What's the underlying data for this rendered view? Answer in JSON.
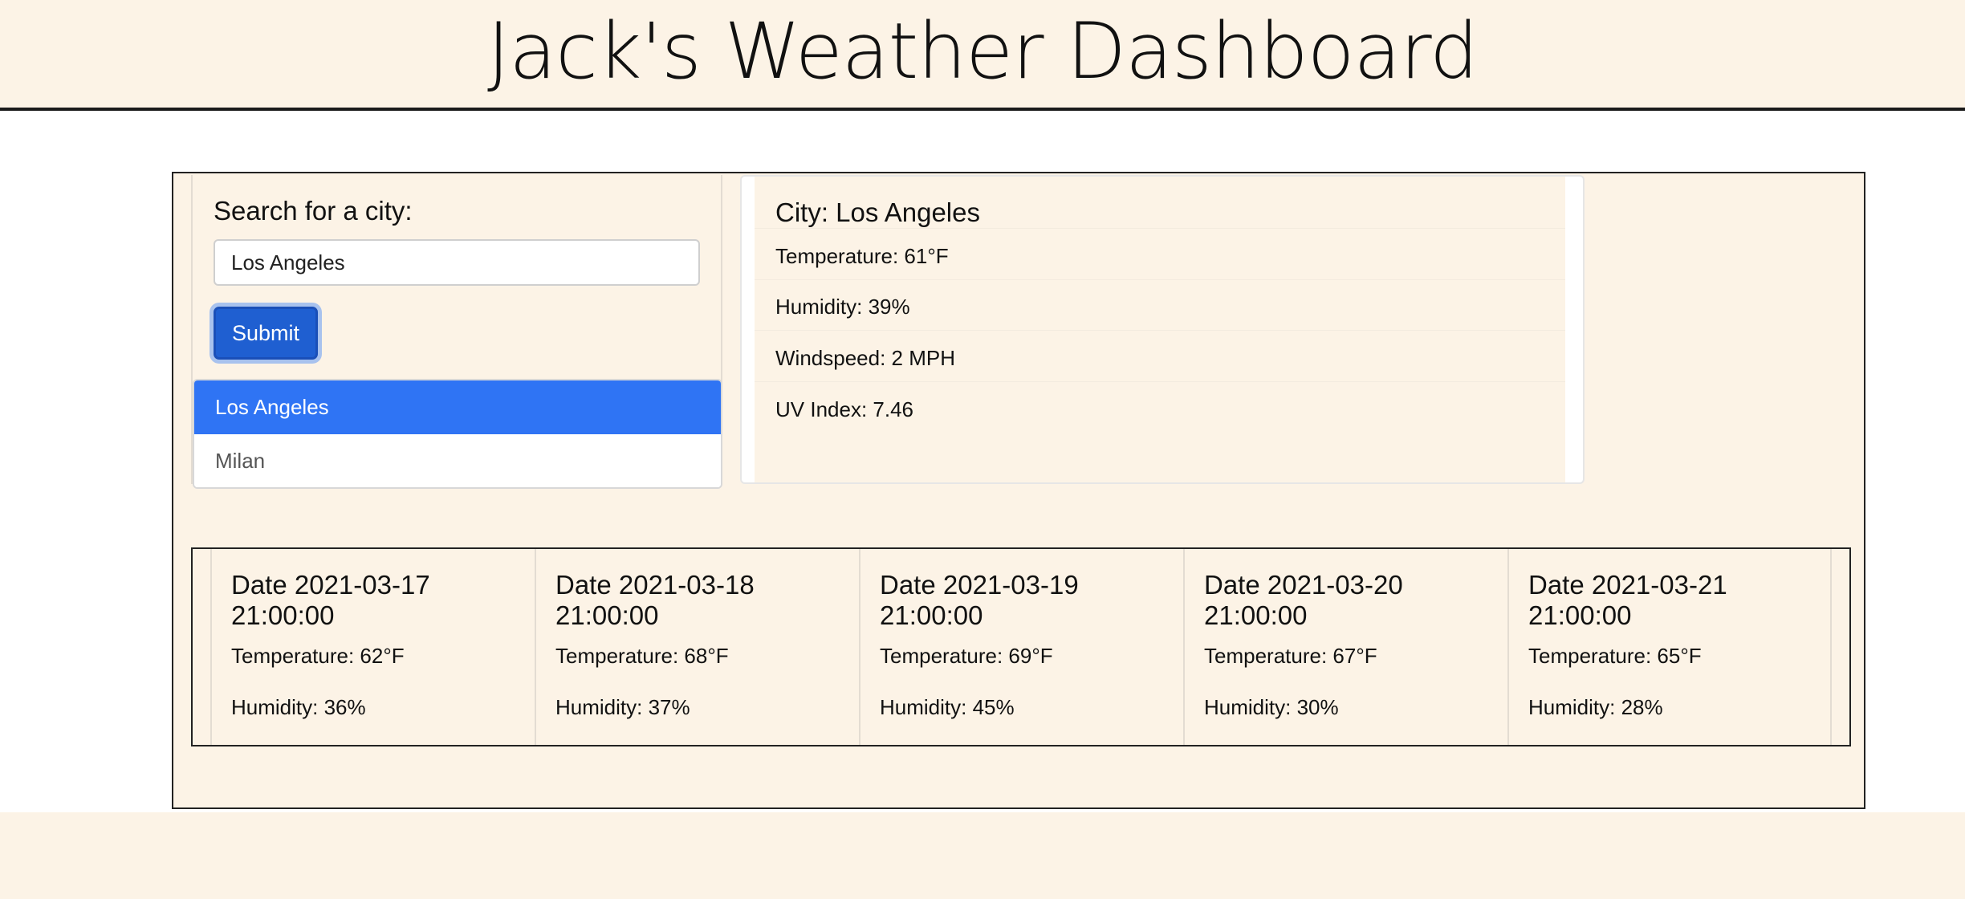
{
  "header": {
    "title": "Jack's Weather Dashboard"
  },
  "search": {
    "label": "Search for a city:",
    "input_value": "Los Angeles",
    "submit_label": "Submit"
  },
  "history": [
    {
      "label": "Los Angeles",
      "active": true
    },
    {
      "label": "Milan",
      "active": false
    }
  ],
  "current": {
    "city": "City: Los Angeles",
    "temperature": "Temperature: 61°F",
    "humidity": "Humidity: 39%",
    "windspeed": "Windspeed: 2 MPH",
    "uv_index": "UV Index: 7.46"
  },
  "forecast": [
    {
      "date": "Date 2021-03-17 21:00:00",
      "temperature": "Temperature: 62°F",
      "humidity": "Humidity: 36%"
    },
    {
      "date": "Date 2021-03-18 21:00:00",
      "temperature": "Temperature: 68°F",
      "humidity": "Humidity: 37%"
    },
    {
      "date": "Date 2021-03-19 21:00:00",
      "temperature": "Temperature: 69°F",
      "humidity": "Humidity: 45%"
    },
    {
      "date": "Date 2021-03-20 21:00:00",
      "temperature": "Temperature: 67°F",
      "humidity": "Humidity: 30%"
    },
    {
      "date": "Date 2021-03-21 21:00:00",
      "temperature": "Temperature: 65°F",
      "humidity": "Humidity: 28%"
    }
  ],
  "colors": {
    "page_background": "#fcf3e6",
    "accent_blue": "#2f74f4",
    "button_blue": "#1f5fd1"
  }
}
